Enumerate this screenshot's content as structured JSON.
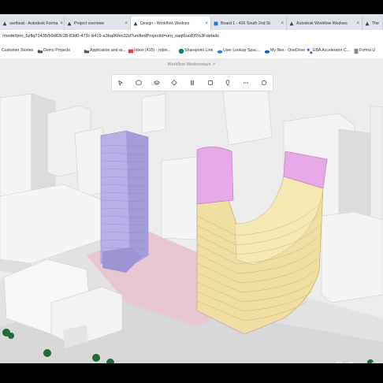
{
  "browser": {
    "tabs": [
      {
        "label": "oartbeat - Autodesk Forma",
        "icon": "forma-icon",
        "active": false
      },
      {
        "label": "Project overview",
        "icon": "forma-icon",
        "active": false
      },
      {
        "label": "Design - Workflow Wednes",
        "icon": "forma-icon",
        "active": true
      },
      {
        "label": "Board 1 - 426 South 2nd St",
        "icon": "board-icon",
        "active": false
      },
      {
        "label": "Autodesk Workflow Wednes",
        "icon": "forma-icon",
        "active": false
      },
      {
        "label": "The",
        "icon": "forma-icon",
        "active": false
      }
    ],
    "url": "/model/pro_5zflq71435/b9d63c28-83d0-473c-b419-a3ba06fec22d?unifiedProjectId=urn_saqt6uo8)5%3Fdetails",
    "bookmarks": [
      {
        "label": "Customer Stories",
        "icon": "folder-icon"
      },
      {
        "label": "Demo Projects",
        "icon": "folder-icon"
      },
      {
        "label": "Application and ar...",
        "icon": "folder-icon"
      },
      {
        "label": "Inbox (415) - robin...",
        "icon": "mail-icon"
      },
      {
        "label": "Sharepoint Link",
        "icon": "sharepoint-icon"
      },
      {
        "label": "User Lookup Spac...",
        "icon": "cloud-icon"
      },
      {
        "label": "My files - OneDrive",
        "icon": "onedrive-icon"
      },
      {
        "label": "EBA Accelerator C...",
        "icon": "grid-icon"
      },
      {
        "label": "Forma U",
        "icon": "doc-icon"
      }
    ]
  },
  "app": {
    "project_title": "Workflow Wednesdays",
    "toolbar": [
      "select-icon",
      "cube-icon",
      "layers-icon",
      "diamond-icon",
      "grid-lines-icon",
      "stack-icon",
      "pin-icon",
      "dots-icon",
      "more-icon"
    ],
    "corner_controls": [
      "share-icon",
      "split-icon",
      "camera-icon",
      "expand-icon"
    ],
    "credit": "Map data ©2023 Mapbox, OpenStreetMap"
  },
  "colors": {
    "tab_bar": "#dfe3ea",
    "ground": "#ececec",
    "building_grey": "#f1f1f1",
    "purple_tower": "#b7b0e6",
    "pink_cap": "#e6a8e6",
    "yellow_facade": "#efe0a2",
    "plaza_pink": "#e7c8d0",
    "tree_green": "#1f6b37"
  }
}
